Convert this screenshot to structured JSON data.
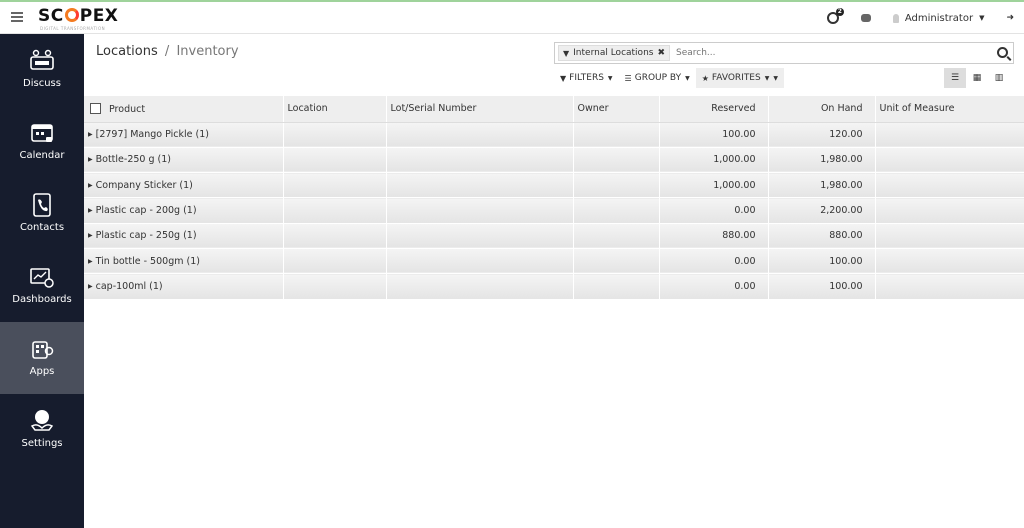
{
  "brand": {
    "logo_left": "SC",
    "logo_right": "PEX",
    "tagline": "DIGITAL TRANSFORMATION"
  },
  "topbar": {
    "activity_badge": "2",
    "user_name": "Administrator"
  },
  "sidebar": {
    "items": [
      {
        "label": "Discuss",
        "icon": "discuss-icon"
      },
      {
        "label": "Calendar",
        "icon": "calendar-icon"
      },
      {
        "label": "Contacts",
        "icon": "contacts-icon"
      },
      {
        "label": "Dashboards",
        "icon": "dashboards-icon"
      },
      {
        "label": "Apps",
        "icon": "apps-icon",
        "active": true
      },
      {
        "label": "Settings",
        "icon": "settings-icon"
      }
    ]
  },
  "breadcrumb": {
    "parent": "Locations",
    "separator": "/",
    "current": "Inventory"
  },
  "search": {
    "facet_label": "Internal Locations",
    "placeholder": "Search..."
  },
  "filters": {
    "filters_label": "FILTERS",
    "groupby_label": "GROUP BY",
    "favorites_label": "FAVORITES"
  },
  "table": {
    "columns": [
      "Product",
      "Location",
      "Lot/Serial Number",
      "Owner",
      "Reserved",
      "On Hand",
      "Unit of Measure"
    ],
    "rows": [
      {
        "product": "[2797] Mango Pickle (1)",
        "reserved": "100.00",
        "on_hand": "120.00"
      },
      {
        "product": "Bottle-250 g (1)",
        "reserved": "1,000.00",
        "on_hand": "1,980.00"
      },
      {
        "product": "Company Sticker (1)",
        "reserved": "1,000.00",
        "on_hand": "1,980.00"
      },
      {
        "product": "Plastic cap - 200g (1)",
        "reserved": "0.00",
        "on_hand": "2,200.00"
      },
      {
        "product": "Plastic cap - 250g (1)",
        "reserved": "880.00",
        "on_hand": "880.00"
      },
      {
        "product": "Tin bottle - 500gm (1)",
        "reserved": "0.00",
        "on_hand": "100.00"
      },
      {
        "product": "cap-100ml (1)",
        "reserved": "0.00",
        "on_hand": "100.00"
      }
    ]
  },
  "colors": {
    "sidebar_bg": "#161c2d",
    "sidebar_active": "#4a4f5c",
    "accent_orange": "#f47b20"
  }
}
